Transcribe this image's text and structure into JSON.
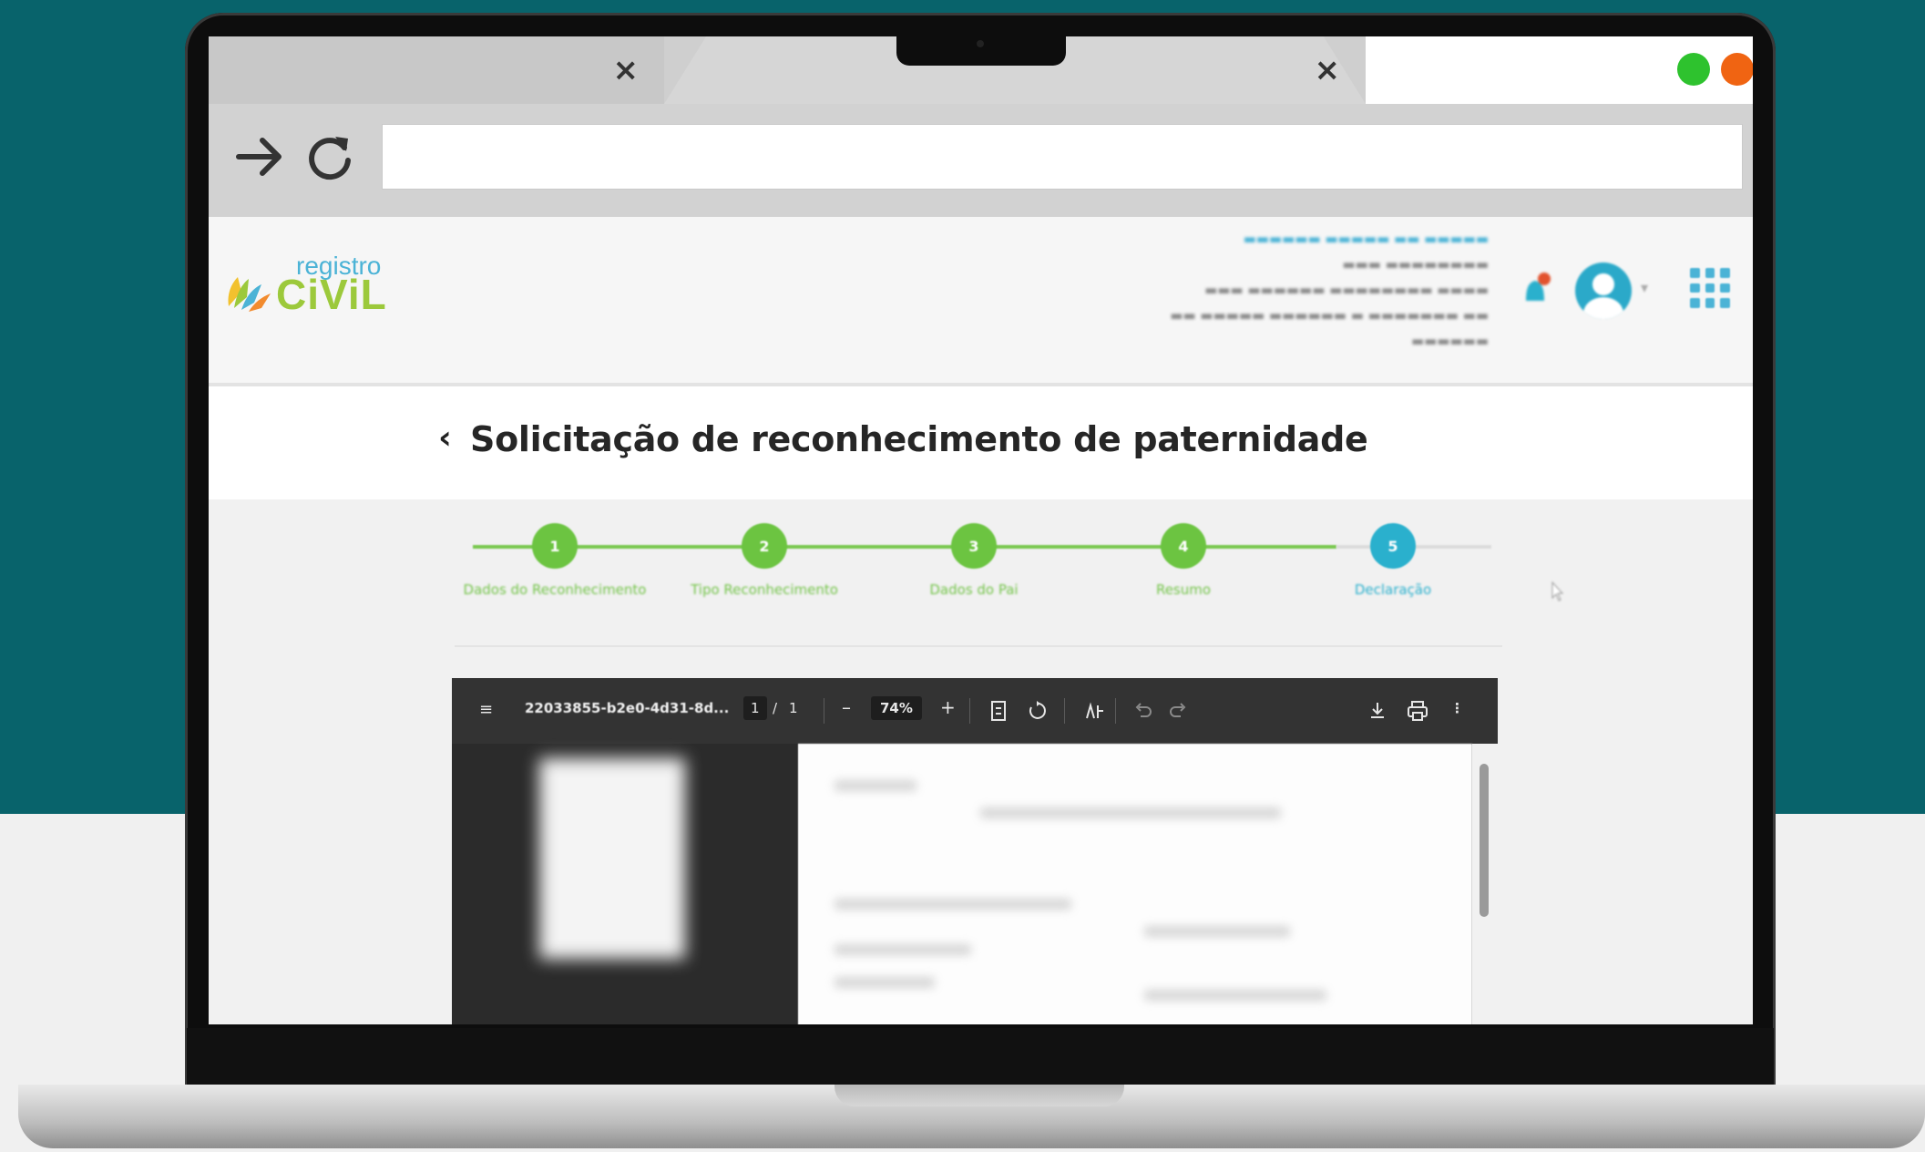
{
  "browser": {
    "tabs": [
      {
        "close_label": "×"
      },
      {
        "close_label": "×"
      }
    ],
    "nav": {
      "forward_icon": "arrow-right-icon",
      "reload_icon": "reload-icon"
    },
    "address": {
      "value": ""
    }
  },
  "header": {
    "logo": {
      "top": "registro",
      "bottom": "CiViL"
    },
    "colors": {
      "accent_blue": "#2ab0cd",
      "accent_green": "#6cc441",
      "teal_background": "#08636b"
    }
  },
  "page": {
    "back_label": "‹",
    "title": "Solicitação de reconhecimento de paternidade"
  },
  "stepper": {
    "steps": [
      {
        "number": "1",
        "label": "Dados do Reconhecimento",
        "status": "done"
      },
      {
        "number": "2",
        "label": "Tipo Reconhecimento",
        "status": "done"
      },
      {
        "number": "3",
        "label": "Dados do Pai",
        "status": "done"
      },
      {
        "number": "4",
        "label": "Resumo",
        "status": "done"
      },
      {
        "number": "5",
        "label": "Declaração",
        "status": "active"
      }
    ]
  },
  "pdf_viewer": {
    "filename": "22033855-b2e0-4d31-8d...",
    "page_current": "1",
    "page_separator": "/",
    "page_total": "1",
    "zoom": "74%",
    "minus": "–",
    "plus": "+"
  }
}
